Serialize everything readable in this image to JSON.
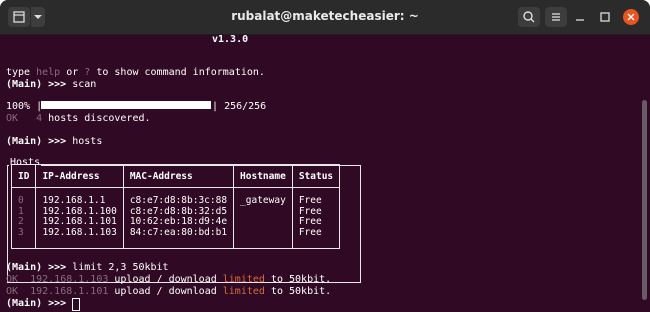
{
  "window": {
    "title": "rubalat@maketecheasier: ~"
  },
  "icons": {
    "new_tab": "new-tab-icon",
    "menu": "dropdown-arrow-icon",
    "search": "search-icon",
    "hamburger": "hamburger-menu-icon",
    "minimize": "minimize-icon",
    "maximize": "maximize-icon",
    "close": "close-icon"
  },
  "colors": {
    "background": "#300a24",
    "titlebar": "#2b2b2b",
    "highlight": "#d96a3f",
    "dim": "#8a6c7f",
    "close": "#e95420"
  },
  "terminal": {
    "version": "v1.3.0",
    "help": {
      "p1": "type ",
      "help_word": "help",
      "p2": " or ",
      "q_word": "?",
      "p3": " to show command information."
    },
    "prompt": "(Main) >>> ",
    "scan_cmd": "scan",
    "progress": {
      "pct": "100%",
      "bar_prefix": "|",
      "bar_suffix": "|",
      "count": "256/256",
      "fraction": 1.0
    },
    "ok_scan": {
      "ok": "OK",
      "num": "4",
      "text": " hosts discovered."
    },
    "hosts_cmd": "hosts",
    "hosts_label": "Hosts",
    "table": {
      "headers": [
        "ID",
        "IP-Address",
        "MAC-Address",
        "Hostname",
        "Status"
      ],
      "rows": [
        [
          "0",
          "192.168.1.1",
          "c8:e7:d8:8b:3c:88",
          "_gateway",
          "Free"
        ],
        [
          "1",
          "192.168.1.100",
          "c8:e7:d8:8b:32:d5",
          "",
          "Free"
        ],
        [
          "2",
          "192.168.1.101",
          "10:62:eb:18:d9:4e",
          "",
          "Free"
        ],
        [
          "3",
          "192.168.1.103",
          "84:c7:ea:80:bd:b1",
          "",
          "Free"
        ]
      ]
    },
    "limit_cmd": "limit 2,3 50kbit",
    "ok_lines": [
      {
        "ok": "OK",
        "ip": "192.168.1.103",
        "t1": " upload / download ",
        "lim": "limited",
        "t2": " to 50kbit."
      },
      {
        "ok": "OK",
        "ip": "192.168.1.101",
        "t1": " upload / download ",
        "lim": "limited",
        "t2": " to 50kbit."
      }
    ]
  }
}
